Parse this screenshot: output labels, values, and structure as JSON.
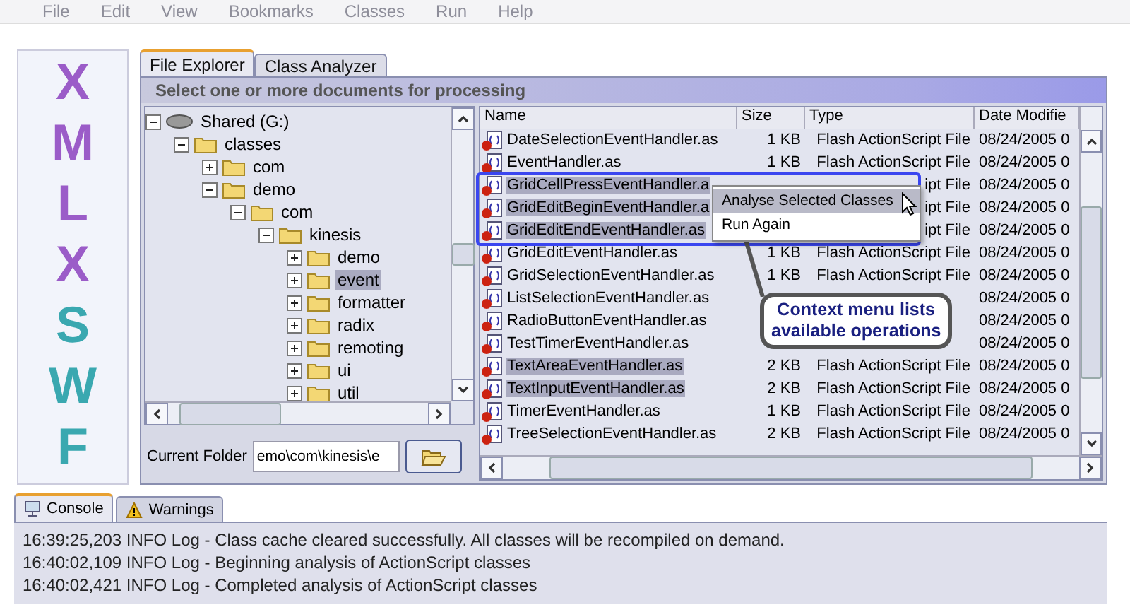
{
  "menu": [
    "File",
    "Edit",
    "View",
    "Bookmarks",
    "Classes",
    "Run",
    "Help"
  ],
  "logo": {
    "letters": [
      "X",
      "M",
      "L",
      "X",
      "S",
      "W",
      "F"
    ]
  },
  "tabs": [
    {
      "label": "File Explorer",
      "selected": true
    },
    {
      "label": "Class Analyzer",
      "selected": false
    }
  ],
  "header": "Select one or more documents for processing",
  "tree": [
    {
      "label": "Shared (G:)",
      "kind": "drive",
      "expanded": true,
      "selected": false,
      "children": [
        {
          "label": "classes",
          "kind": "folder",
          "expanded": true,
          "selected": false,
          "children": [
            {
              "label": "com",
              "kind": "folder",
              "expanded": false,
              "selected": false
            },
            {
              "label": "demo",
              "kind": "folder",
              "expanded": true,
              "selected": false,
              "children": [
                {
                  "label": "com",
                  "kind": "folder",
                  "expanded": true,
                  "selected": false,
                  "children": [
                    {
                      "label": "kinesis",
                      "kind": "folder",
                      "expanded": true,
                      "selected": false,
                      "children": [
                        {
                          "label": "demo",
                          "kind": "folder",
                          "expanded": false,
                          "selected": false
                        },
                        {
                          "label": "event",
                          "kind": "folder",
                          "expanded": false,
                          "selected": true
                        },
                        {
                          "label": "formatter",
                          "kind": "folder",
                          "expanded": false,
                          "selected": false
                        },
                        {
                          "label": "radix",
                          "kind": "folder",
                          "expanded": false,
                          "selected": false
                        },
                        {
                          "label": "remoting",
                          "kind": "folder",
                          "expanded": false,
                          "selected": false
                        },
                        {
                          "label": "ui",
                          "kind": "folder",
                          "expanded": false,
                          "selected": false
                        },
                        {
                          "label": "util",
                          "kind": "folder",
                          "expanded": false,
                          "selected": false
                        }
                      ]
                    }
                  ]
                }
              ]
            }
          ]
        }
      ]
    }
  ],
  "current_folder": {
    "label": "Current Folder",
    "value": "emo\\com\\kinesis\\e"
  },
  "files": {
    "columns": [
      "Name",
      "Size",
      "Type",
      "Date Modifie"
    ],
    "rows": [
      {
        "name": "DateSelectionEventHandler.as",
        "size": "1 KB",
        "type": "Flash ActionScript File",
        "date": "08/24/2005 0",
        "selected": false
      },
      {
        "name": "EventHandler.as",
        "size": "1 KB",
        "type": "Flash ActionScript File",
        "date": "08/24/2005 0",
        "selected": false
      },
      {
        "name": "GridCellPressEventHandler.a",
        "type": "ipt File",
        "date": "08/24/2005 0",
        "selected": true
      },
      {
        "name": "GridEditBeginEventHandler.a",
        "type": "ipt File",
        "date": "08/24/2005 0",
        "selected": true
      },
      {
        "name": "GridEditEndEventHandler.as",
        "type": "ipt File",
        "date": "08/24/2005 0",
        "selected": true
      },
      {
        "name": "GridEditEventHandler.as",
        "size": "1 KB",
        "type": "Flash ActionScript File",
        "date": "08/24/2005 0",
        "selected": false
      },
      {
        "name": "GridSelectionEventHandler.as",
        "size": "1 KB",
        "type": "Flash ActionScript File",
        "date": "08/24/2005 0",
        "selected": false
      },
      {
        "name": "ListSelectionEventHandler.as",
        "date": "08/24/2005 0",
        "selected": false
      },
      {
        "name": "RadioButtonEventHandler.as",
        "date": "08/24/2005 0",
        "selected": false
      },
      {
        "name": "TestTimerEventHandler.as",
        "date": "08/24/2005 0",
        "selected": false
      },
      {
        "name": "TextAreaEventHandler.as",
        "size": "2 KB",
        "type": "Flash ActionScript File",
        "date": "08/24/2005 0",
        "selected": true
      },
      {
        "name": "TextInputEventHandler.as",
        "size": "2 KB",
        "type": "Flash ActionScript File",
        "date": "08/24/2005 0",
        "selected": true
      },
      {
        "name": "TimerEventHandler.as",
        "size": "1 KB",
        "type": "Flash ActionScript File",
        "date": "08/24/2005 0",
        "selected": false
      },
      {
        "name": "TreeSelectionEventHandler.as",
        "size": "2 KB",
        "type": "Flash ActionScript File",
        "date": "08/24/2005 0",
        "selected": false
      }
    ]
  },
  "context_menu": [
    {
      "label": "Analyse Selected Classes",
      "selected": true
    },
    {
      "label": "Run Again",
      "selected": false
    }
  ],
  "callout": {
    "lines": [
      "Context menu lists",
      "available operations"
    ]
  },
  "console": {
    "tabs": [
      {
        "label": "Console",
        "kind": "console",
        "selected": true
      },
      {
        "label": "Warnings",
        "kind": "warning",
        "selected": false
      }
    ],
    "lines": [
      "16:39:25,203 INFO Log  - Class cache cleared successfully. All classes will be recompiled on demand.",
      "16:40:02,109 INFO Log  - Beginning analysis of ActionScript classes",
      "16:40:02,421 INFO Log  - Completed analysis of ActionScript classes"
    ]
  }
}
